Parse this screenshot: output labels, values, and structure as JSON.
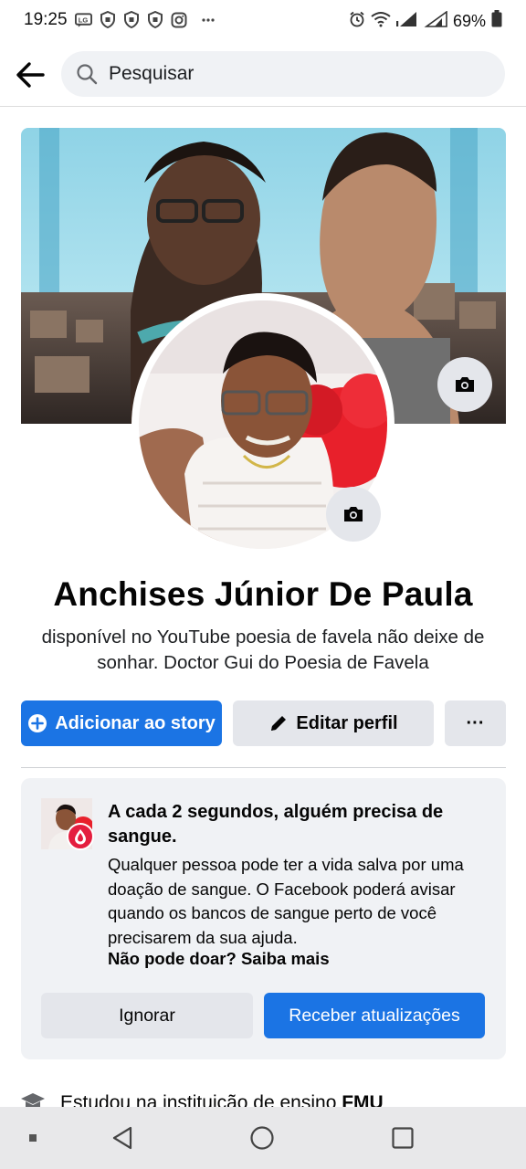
{
  "status_bar": {
    "time": "19:25",
    "battery": "69%",
    "icons": [
      "lg-icon",
      "shield-icon",
      "shield-icon",
      "shield-icon",
      "instagram-icon",
      "more-dots-icon"
    ],
    "right_icons": [
      "alarm-icon",
      "wifi-icon",
      "signal-icon",
      "signal-icon",
      "battery-icon"
    ]
  },
  "header": {
    "search_placeholder": "Pesquisar"
  },
  "profile": {
    "name": "Anchises Júnior De Paula",
    "bio": "disponível no YouTube poesia de favela não deixe de sonhar. Doctor Gui do Poesia de Favela"
  },
  "actions": {
    "add_story": "Adicionar ao story",
    "edit_profile": "Editar perfil",
    "more": "···"
  },
  "blood_card": {
    "title": "A cada 2 segundos, alguém precisa de sangue.",
    "body": "Qualquer pessoa pode ter a vida salva por uma doação de sangue. O Facebook poderá avisar quando os bancos de sangue perto de você precisarem da sua ajuda.",
    "link": "Não pode doar? Saiba mais",
    "ignore_label": "Ignorar",
    "receive_label": "Receber atualizações"
  },
  "intro": {
    "study": "Estudou na instituição de ensino ",
    "school": "FMU"
  },
  "colors": {
    "accent": "#1b74e4",
    "surface": "#f0f2f5",
    "button_gray": "#e4e6eb",
    "blood_red": "#e41e3f"
  }
}
